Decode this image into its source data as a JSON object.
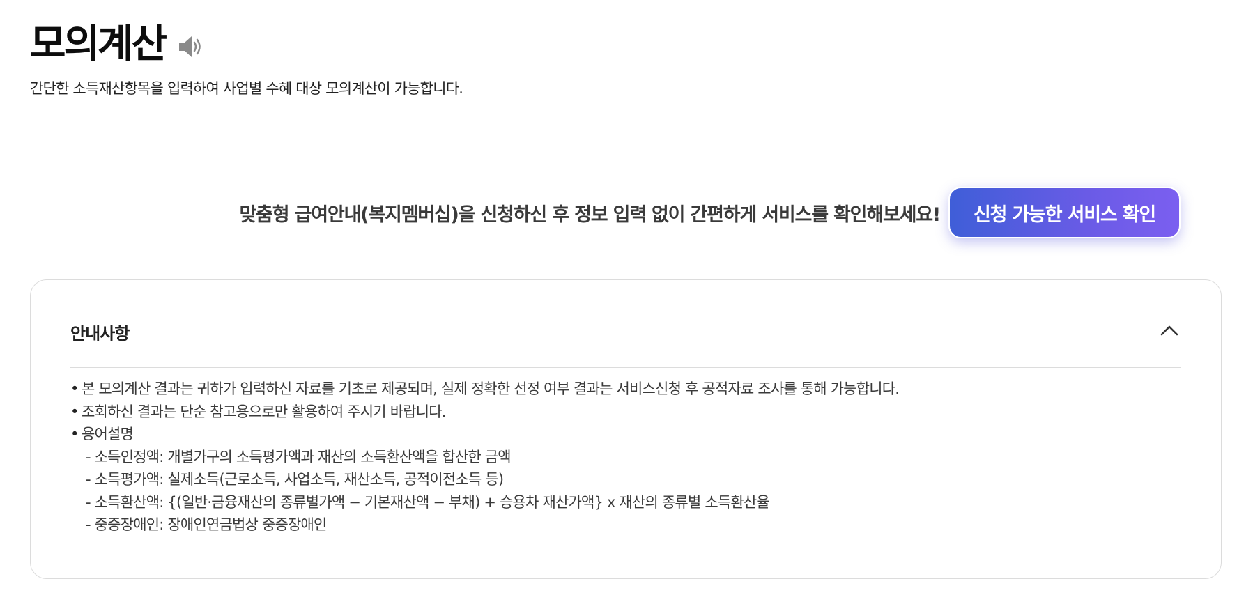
{
  "header": {
    "title": "모의계산",
    "speaker_icon": "speaker-icon",
    "subtitle": "간단한 소득재산항목을 입력하여 사업별 수혜 대상 모의계산이 가능합니다."
  },
  "promo": {
    "text": "맞춤형 급여안내(복지멤버십)을 신청하신 후 정보 입력 없이 간편하게 서비스를 확인해보세요!",
    "button_label": "신청 가능한 서비스 확인",
    "button_gradient_start": "#3f5ed8",
    "button_gradient_end": "#7b5ff0"
  },
  "notice": {
    "title": "안내사항",
    "toggle_icon": "chevron-up-icon",
    "items": [
      "본 모의계산 결과는 귀하가 입력하신 자료를 기초로 제공되며, 실제 정확한 선정 여부 결과는 서비스신청 후 공적자료 조사를 통해 가능합니다.",
      "조회하신 결과는 단순 참고용으로만 활용하여 주시기 바랍니다.",
      "용어설명"
    ],
    "terms": [
      "- 소득인정액: 개별가구의 소득평가액과 재산의 소득환산액을 합산한 금액",
      "- 소득평가액: 실제소득(근로소득, 사업소득, 재산소득, 공적이전소득 등)",
      "- 소득환산액: {(일반·금융재산의 종류별가액 − 기본재산액 − 부채) + 승용차 재산가액} x 재산의 종류별 소득환산율",
      "- 중증장애인: 장애인연금법상 중증장애인"
    ]
  }
}
